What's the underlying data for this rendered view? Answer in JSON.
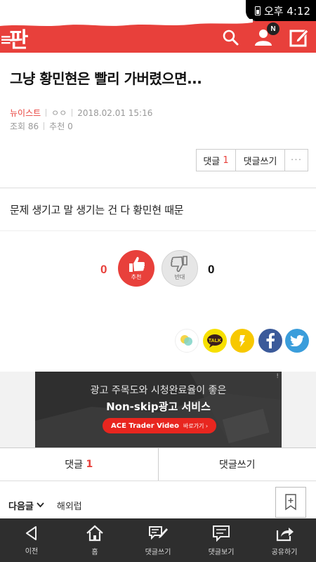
{
  "status_bar": {
    "time": "오후 4:12"
  },
  "header": {
    "logo": "판",
    "notification_badge": "N",
    "brand_color": "#e8403b"
  },
  "article": {
    "title": "그냥 황민현은 빨리 가버렸으면...",
    "source": "뉴이스트",
    "author": "ㅇㅇ",
    "datetime": "2018.02.01 15:16",
    "views_label": "조회 86",
    "recommend_label": "추천 0",
    "body": "문제 생기고 말 생기는 건 다 황민현 때문"
  },
  "actions": {
    "comment_label": "댓글",
    "comment_count": "1",
    "write_comment_label": "댓글쓰기",
    "more_label": "···"
  },
  "votes": {
    "up_count": "0",
    "up_label": "추천",
    "down_count": "0",
    "down_label": "반대"
  },
  "share": {
    "icons": [
      "share-app-icon",
      "kakaotalk-icon",
      "kakaostory-icon",
      "facebook-icon",
      "twitter-icon"
    ],
    "kakaotalk_text": "TALK"
  },
  "ad": {
    "line1": "광고 주목도와 시청완료율이 좋은",
    "line2": "Non-skip광고 서비스",
    "cta_brand": "ACE Trader Video",
    "cta_action": "바로가기 ›",
    "info": "!"
  },
  "comment_bar": {
    "comments_label": "댓글",
    "comments_count": "1",
    "write_label": "댓글쓰기"
  },
  "next_article": {
    "label": "다음글",
    "title": "해외럽"
  },
  "nav": {
    "items": [
      {
        "label": "이전",
        "icon": "back-arrow-icon"
      },
      {
        "label": "홈",
        "icon": "home-icon"
      },
      {
        "label": "댓글쓰기",
        "icon": "write-comment-icon"
      },
      {
        "label": "댓글보기",
        "icon": "view-comments-icon"
      },
      {
        "label": "공유하기",
        "icon": "share-icon"
      }
    ]
  }
}
